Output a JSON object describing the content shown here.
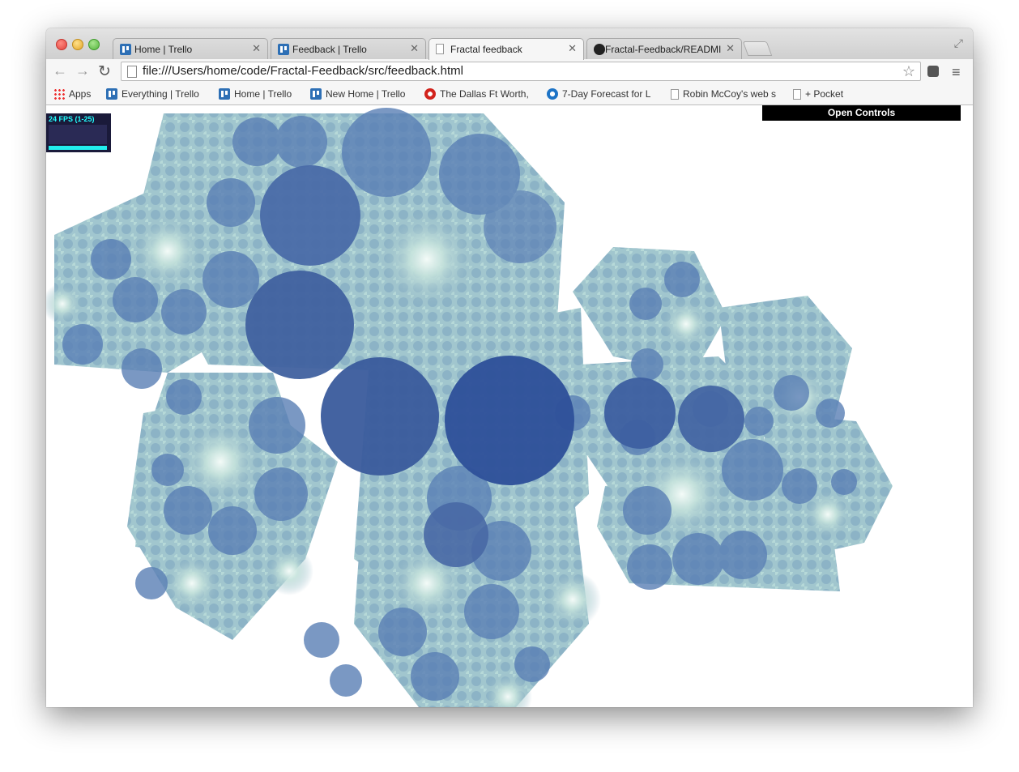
{
  "browser": {
    "tabs": [
      {
        "label": "Home | Trello",
        "icon": "trello-icon"
      },
      {
        "label": "Feedback | Trello",
        "icon": "trello-icon"
      },
      {
        "label": "Fractal feedback",
        "icon": "page-icon"
      },
      {
        "label": "Fractal-Feedback/READMI",
        "icon": "github-icon"
      }
    ],
    "active_tab": 2,
    "url": "file:///Users/home/code/Fractal-Feedback/src/feedback.html",
    "bookmarks": [
      {
        "label": "Apps",
        "icon": "apps-icon"
      },
      {
        "label": "Everything | Trello",
        "icon": "trello-icon"
      },
      {
        "label": "Home | Trello",
        "icon": "trello-icon"
      },
      {
        "label": "New Home | Trello",
        "icon": "trello-icon"
      },
      {
        "label": "The Dallas Ft Worth,",
        "icon": "gear-icon"
      },
      {
        "label": "7-Day Forecast for L",
        "icon": "noaa-icon"
      },
      {
        "label": "Robin McCoy's web s",
        "icon": "page-icon"
      },
      {
        "label": "+ Pocket",
        "icon": "page-icon"
      }
    ]
  },
  "page": {
    "fps_label": "24 FPS (1-25)",
    "open_controls_label": "Open Controls"
  },
  "colors": {
    "circle_dark": "#30529a",
    "circle_mid": "#5a7fb5",
    "hex_fill": "#8fb8c8",
    "glow": "#e8f6f2"
  }
}
